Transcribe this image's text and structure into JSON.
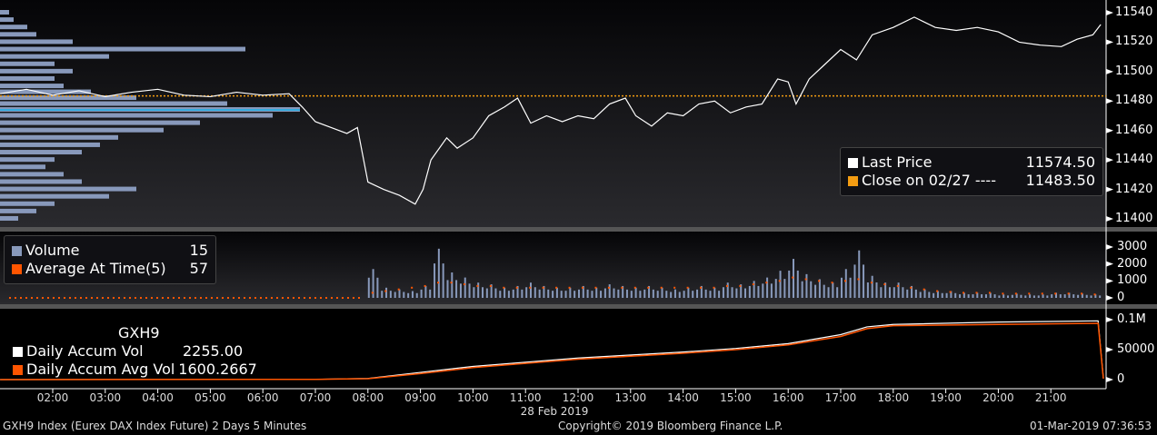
{
  "chart_data": [
    {
      "type": "line",
      "title": "Price",
      "yticks": [
        11400,
        11420,
        11440,
        11460,
        11480,
        11500,
        11520,
        11540
      ],
      "ylim": [
        11395,
        11545
      ],
      "series": [
        {
          "name": "Last Price",
          "value": "11574.50",
          "color": "#ffffff",
          "points": [
            [
              1,
              11485
            ],
            [
              1.5,
              11488
            ],
            [
              2,
              11484
            ],
            [
              2.5,
              11487
            ],
            [
              3,
              11483
            ],
            [
              3.5,
              11486
            ],
            [
              4,
              11488
            ],
            [
              4.5,
              11484
            ],
            [
              5,
              11483
            ],
            [
              5.5,
              11486
            ],
            [
              6,
              11484
            ],
            [
              6.5,
              11485
            ],
            [
              6.75,
              11476
            ],
            [
              7,
              11466
            ],
            [
              7.3,
              11462
            ],
            [
              7.6,
              11458
            ],
            [
              7.8,
              11462
            ],
            [
              8,
              11425
            ],
            [
              8.3,
              11420
            ],
            [
              8.6,
              11416
            ],
            [
              8.9,
              11410
            ],
            [
              9.05,
              11420
            ],
            [
              9.2,
              11440
            ],
            [
              9.5,
              11455
            ],
            [
              9.7,
              11448
            ],
            [
              10,
              11455
            ],
            [
              10.3,
              11470
            ],
            [
              10.6,
              11476
            ],
            [
              10.85,
              11482
            ],
            [
              11.1,
              11465
            ],
            [
              11.4,
              11470
            ],
            [
              11.7,
              11466
            ],
            [
              12,
              11470
            ],
            [
              12.3,
              11468
            ],
            [
              12.6,
              11478
            ],
            [
              12.9,
              11482
            ],
            [
              13.1,
              11470
            ],
            [
              13.4,
              11463
            ],
            [
              13.7,
              11472
            ],
            [
              14,
              11470
            ],
            [
              14.3,
              11478
            ],
            [
              14.6,
              11480
            ],
            [
              14.9,
              11472
            ],
            [
              15.2,
              11476
            ],
            [
              15.5,
              11478
            ],
            [
              15.8,
              11495
            ],
            [
              16,
              11493
            ],
            [
              16.15,
              11478
            ],
            [
              16.4,
              11495
            ],
            [
              16.7,
              11505
            ],
            [
              17,
              11515
            ],
            [
              17.3,
              11508
            ],
            [
              17.6,
              11525
            ],
            [
              18,
              11530
            ],
            [
              18.4,
              11537
            ],
            [
              18.8,
              11530
            ],
            [
              19.2,
              11528
            ],
            [
              19.6,
              11530
            ],
            [
              20,
              11527
            ],
            [
              20.4,
              11520
            ],
            [
              20.8,
              11518
            ],
            [
              21.2,
              11517
            ],
            [
              21.5,
              11522
            ],
            [
              21.8,
              11525
            ],
            [
              21.95,
              11532
            ]
          ]
        },
        {
          "name": "Close on 02/27 ----",
          "value": "11483.50",
          "color": "#f39c12",
          "level": 11483.5
        }
      ],
      "volume_profile": {
        "color": "#8899bb",
        "poc": 11474,
        "levels": [
          [
            11400,
            20
          ],
          [
            11405,
            40
          ],
          [
            11410,
            60
          ],
          [
            11415,
            120
          ],
          [
            11420,
            150
          ],
          [
            11425,
            90
          ],
          [
            11430,
            70
          ],
          [
            11435,
            50
          ],
          [
            11440,
            60
          ],
          [
            11445,
            90
          ],
          [
            11450,
            110
          ],
          [
            11455,
            130
          ],
          [
            11460,
            180
          ],
          [
            11465,
            220
          ],
          [
            11470,
            300
          ],
          [
            11474,
            330
          ],
          [
            11478,
            250
          ],
          [
            11482,
            150
          ],
          [
            11486,
            100
          ],
          [
            11490,
            70
          ],
          [
            11495,
            60
          ],
          [
            11500,
            80
          ],
          [
            11505,
            60
          ],
          [
            11510,
            120
          ],
          [
            11515,
            270
          ],
          [
            11520,
            80
          ],
          [
            11525,
            40
          ],
          [
            11530,
            30
          ],
          [
            11535,
            15
          ],
          [
            11540,
            10
          ]
        ]
      }
    },
    {
      "type": "bar",
      "title": "Volume",
      "yticks": [
        0,
        1000,
        2000,
        3000
      ],
      "ylim": [
        0,
        3500
      ],
      "series": [
        {
          "name": "Volume",
          "value": "15",
          "color": "#8899bb"
        },
        {
          "name": "Average At Time(5)",
          "value": "57",
          "color": "#ff5500"
        }
      ],
      "bar_times_start": 8,
      "bar_interval_hours": 0.25,
      "volume": [
        1700,
        600,
        500,
        400,
        700,
        2900,
        1500,
        1200,
        900,
        800,
        600,
        700,
        900,
        700,
        600,
        600,
        700,
        600,
        800,
        700,
        600,
        700,
        600,
        500,
        600,
        700,
        600,
        900,
        800,
        1000,
        1200,
        1600,
        2300,
        1400,
        1100,
        900,
        1700,
        2800,
        1300,
        900,
        900,
        700,
        500,
        400,
        400,
        300,
        300,
        300,
        200,
        250,
        200,
        200,
        300,
        300,
        250,
        200
      ],
      "avg": [
        300,
        400,
        500,
        600,
        700,
        900,
        900,
        800,
        700,
        700,
        600,
        600,
        600,
        600,
        600,
        600,
        600,
        600,
        600,
        600,
        600,
        600,
        600,
        600,
        600,
        600,
        600,
        700,
        700,
        800,
        900,
        1000,
        1200,
        1100,
        1000,
        900,
        1000,
        1100,
        900,
        800,
        700,
        600,
        500,
        400,
        350,
        300,
        300,
        300,
        250,
        250,
        250,
        250,
        250,
        250,
        250,
        200
      ]
    },
    {
      "type": "line",
      "title": "GXH9",
      "yticks": [
        "0",
        "50000",
        "0.1M"
      ],
      "ylim": [
        0,
        105000
      ],
      "series": [
        {
          "name": "Daily Accum Vol",
          "value": "2255.00",
          "color": "#ffffff",
          "points": [
            [
              1,
              0
            ],
            [
              7,
              500
            ],
            [
              8,
              2000
            ],
            [
              9,
              12000
            ],
            [
              10,
              22000
            ],
            [
              12,
              36000
            ],
            [
              14,
              46000
            ],
            [
              15,
              52000
            ],
            [
              16,
              60000
            ],
            [
              17,
              75000
            ],
            [
              17.5,
              88000
            ],
            [
              18,
              92000
            ],
            [
              20,
              96000
            ],
            [
              21.9,
              98000
            ],
            [
              22,
              2255
            ]
          ]
        },
        {
          "name": "Daily Accum Avg Vol",
          "value": "1600.2667",
          "color": "#ff5500",
          "points": [
            [
              1,
              0
            ],
            [
              7,
              400
            ],
            [
              8,
              1500
            ],
            [
              9,
              10000
            ],
            [
              10,
              20000
            ],
            [
              12,
              34000
            ],
            [
              14,
              44000
            ],
            [
              15,
              50000
            ],
            [
              16,
              58000
            ],
            [
              17,
              72000
            ],
            [
              17.5,
              85000
            ],
            [
              18,
              90000
            ],
            [
              20,
              92000
            ],
            [
              21.9,
              94000
            ],
            [
              22,
              1600
            ]
          ]
        }
      ]
    }
  ],
  "x_axis": {
    "ticks": [
      "02:00",
      "03:00",
      "04:00",
      "05:00",
      "06:00",
      "07:00",
      "08:00",
      "09:00",
      "10:00",
      "11:00",
      "12:00",
      "13:00",
      "14:00",
      "15:00",
      "16:00",
      "17:00",
      "18:00",
      "19:00",
      "20:00",
      "21:00"
    ],
    "date_label": "28 Feb 2019"
  },
  "footer": {
    "left": "GXH9 Index (Eurex DAX Index Future) 2 Days 5 Minutes",
    "center": "Copyright© 2019 Bloomberg Finance L.P.",
    "right": "01-Mar-2019 07:36:53"
  }
}
